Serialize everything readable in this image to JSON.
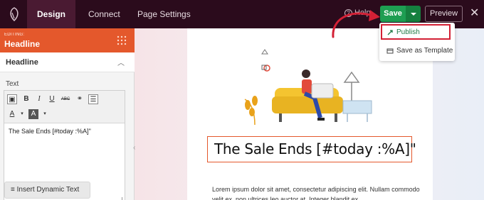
{
  "topbar": {
    "tabs": [
      {
        "label": "Design",
        "active": true
      },
      {
        "label": "Connect",
        "active": false
      },
      {
        "label": "Page Settings",
        "active": false
      }
    ],
    "help_label": "Help",
    "save_label": "Save",
    "preview_label": "Preview",
    "close_icon": "close-icon"
  },
  "save_menu": {
    "items": [
      {
        "label": "Publish",
        "icon": "rocket-icon"
      },
      {
        "label": "Save as Template",
        "icon": "template-icon"
      }
    ]
  },
  "panel": {
    "editing_caption": "EDITING:",
    "editing_title": "Headline",
    "section_title": "Headline",
    "text_label": "Text",
    "editor_content": "The Sale Ends [#today :%A]\"",
    "dynamic_button": "Insert Dynamic Text"
  },
  "canvas": {
    "headline": "The Sale Ends [#today :%A]\"",
    "body": "Lorem ipsum dolor sit amet, consectetur adipiscing elit. Nullam commodo velit ex, non ultrices leo auctor at. Integer blandit ex"
  },
  "colors": {
    "topbar": "#2b0b1c",
    "accent": "#e4582c",
    "save_green": "#1e9e52",
    "highlight_red": "#d32035"
  }
}
